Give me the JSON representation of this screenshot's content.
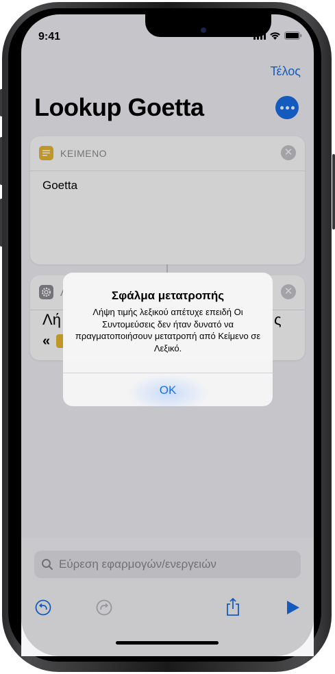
{
  "status_bar": {
    "time": "9:41"
  },
  "nav": {
    "done_label": "Τέλος"
  },
  "shortcut": {
    "title": "Lookup Goetta"
  },
  "actions": [
    {
      "label": "ΚΕΙΜΕΝΟ",
      "icon": "text-document-icon",
      "icon_color": "#e8b931",
      "content": "Goetta"
    },
    {
      "label": "Λ",
      "icon": "gear-icon",
      "icon_color": "#8e8e93",
      "content_partial_left": "Λή",
      "content_partial_right": "ς",
      "quote": "«"
    }
  ],
  "alert": {
    "title": "Σφάλμα μετατροπής",
    "message": "Λήψη τιμής λεξικού απέτυχε επειδή Οι Συντομεύσεις δεν ήταν δυνατό να πραγματοποιήσουν μετατροπή από Κείμενο σε Λεξικό.",
    "ok_label": "OK"
  },
  "search": {
    "placeholder": "Εύρεση εφαρμογών/ενεργειών"
  },
  "toolbar": {
    "undo_icon": "undo-icon",
    "redo_icon": "redo-icon",
    "share_icon": "share-icon",
    "run_icon": "play-icon",
    "accent": "#1a6fe8"
  }
}
